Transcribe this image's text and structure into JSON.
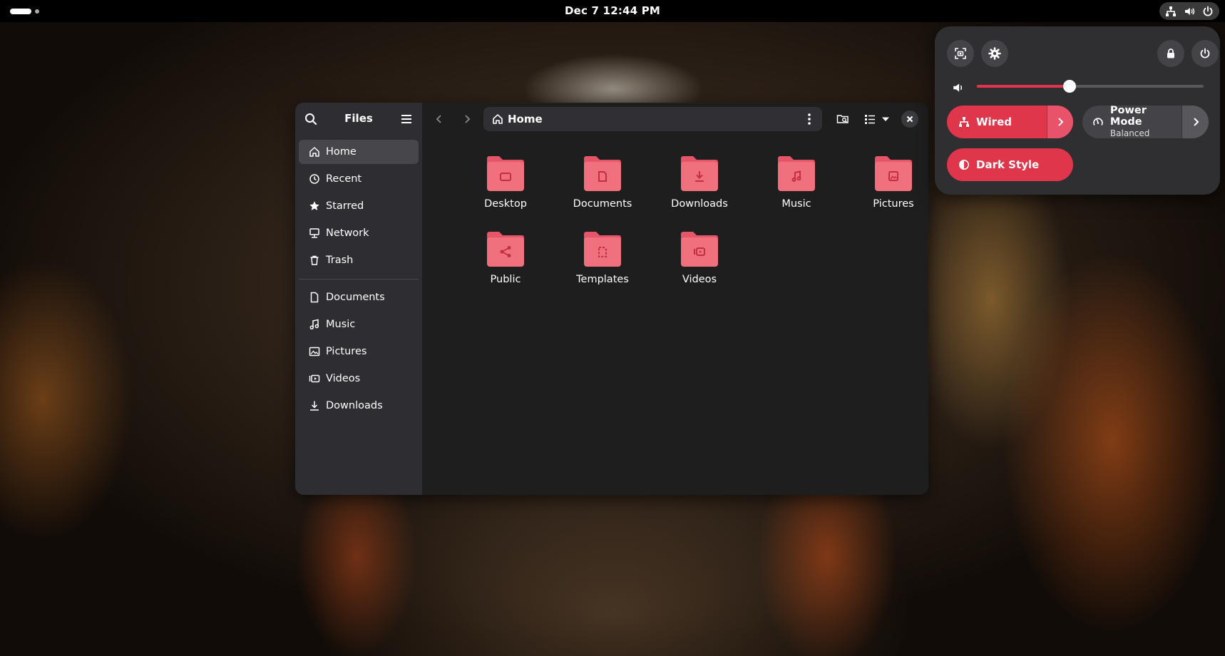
{
  "topbar": {
    "clock": "Dec 7  12:44 PM"
  },
  "files": {
    "title": "Files",
    "path": "Home",
    "places": [
      {
        "label": "Home",
        "icon": "home-icon",
        "active": true
      },
      {
        "label": "Recent",
        "icon": "clock-icon"
      },
      {
        "label": "Starred",
        "icon": "star-icon"
      },
      {
        "label": "Network",
        "icon": "network-icon"
      },
      {
        "label": "Trash",
        "icon": "trash-icon"
      }
    ],
    "bookmarks": [
      {
        "label": "Documents",
        "icon": "document-icon"
      },
      {
        "label": "Music",
        "icon": "music-icon"
      },
      {
        "label": "Pictures",
        "icon": "picture-icon"
      },
      {
        "label": "Videos",
        "icon": "video-icon"
      },
      {
        "label": "Downloads",
        "icon": "download-icon"
      }
    ],
    "folders": [
      {
        "label": "Desktop",
        "icon": "desktop-folder-icon"
      },
      {
        "label": "Documents",
        "icon": "documents-folder-icon"
      },
      {
        "label": "Downloads",
        "icon": "downloads-folder-icon"
      },
      {
        "label": "Music",
        "icon": "music-folder-icon"
      },
      {
        "label": "Pictures",
        "icon": "pictures-folder-icon"
      },
      {
        "label": "Public",
        "icon": "public-folder-icon"
      },
      {
        "label": "Templates",
        "icon": "templates-folder-icon"
      },
      {
        "label": "Videos",
        "icon": "videos-folder-icon"
      }
    ]
  },
  "quick_settings": {
    "volume_level": 0.41,
    "wired_label": "Wired",
    "power_mode_label": "Power Mode",
    "power_mode_value": "Balanced",
    "dark_style_label": "Dark Style"
  },
  "colors": {
    "accent": "#e0364c",
    "folder": "#f0707e",
    "folder_tab": "#e5566a",
    "folder_glyph": "#c22e45"
  }
}
